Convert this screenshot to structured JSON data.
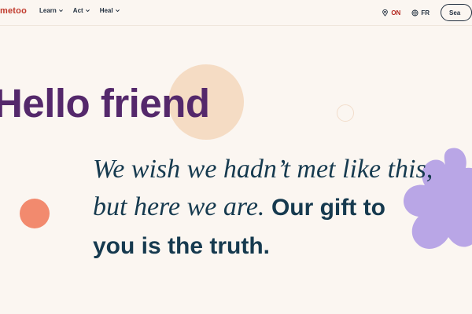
{
  "header": {
    "logo": "metoo",
    "nav": [
      {
        "label": "Learn"
      },
      {
        "label": "Act"
      },
      {
        "label": "Heal"
      }
    ],
    "region": "ON",
    "language": "FR",
    "search_label": "Sea"
  },
  "hero": {
    "title": "Hello friend",
    "quote_italic_1": "We wish we hadn’t met like this,",
    "quote_italic_2": "but here we are.",
    "quote_bold_1": "Our gift to",
    "quote_bold_2": "you is the truth."
  },
  "icons": [
    "location-pin-icon",
    "globe-icon",
    "chevron-down-icon"
  ],
  "colors": {
    "background": "#fbf6f1",
    "title": "#54286b",
    "quote": "#163a4f",
    "brand": "#c0392b",
    "peach": "#f5dcc4",
    "orange": "#f28a6e",
    "lavender": "#b9a6e6"
  }
}
